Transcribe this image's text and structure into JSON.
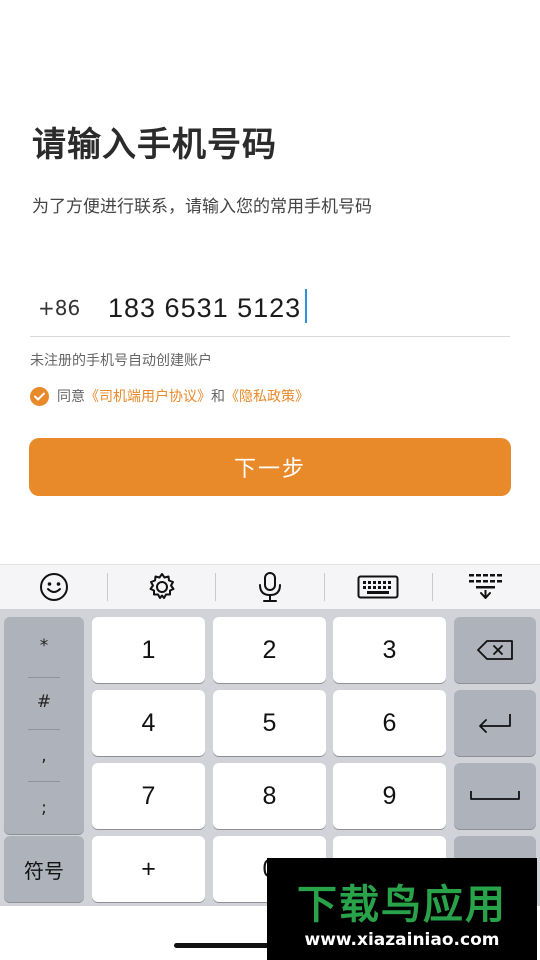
{
  "header": {
    "title": "请输入手机号码",
    "subtitle": "为了方便进行联系，请输入您的常用手机号码"
  },
  "phone": {
    "country_code": "+86",
    "value": "183 6531 5123"
  },
  "hint": "未注册的手机号自动创建账户",
  "agreement": {
    "checked": true,
    "prefix": "同意",
    "link1": "《司机端用户协议》",
    "conj": "和",
    "link2": "《隐私政策》"
  },
  "next_button": {
    "label": "下一步"
  },
  "keyboard": {
    "toolbar_icons": [
      "smiley-icon",
      "gear-icon",
      "microphone-icon",
      "keyboard-icon",
      "collapse-keyboard-icon"
    ],
    "symbols": [
      "*",
      "#",
      ",",
      ";"
    ],
    "digits": [
      "1",
      "2",
      "3",
      "4",
      "5",
      "6",
      "7",
      "8",
      "9",
      "0"
    ],
    "symbol_key": "符号",
    "plus_key": "+"
  },
  "watermark": {
    "title": "下载鸟应用",
    "url": "www.xiazainiao.com"
  },
  "colors": {
    "accent": "#e8892a",
    "caret": "#2f8fe0",
    "keyboard_bg": "#d1d3d9",
    "watermark_green": "#29a34a"
  }
}
